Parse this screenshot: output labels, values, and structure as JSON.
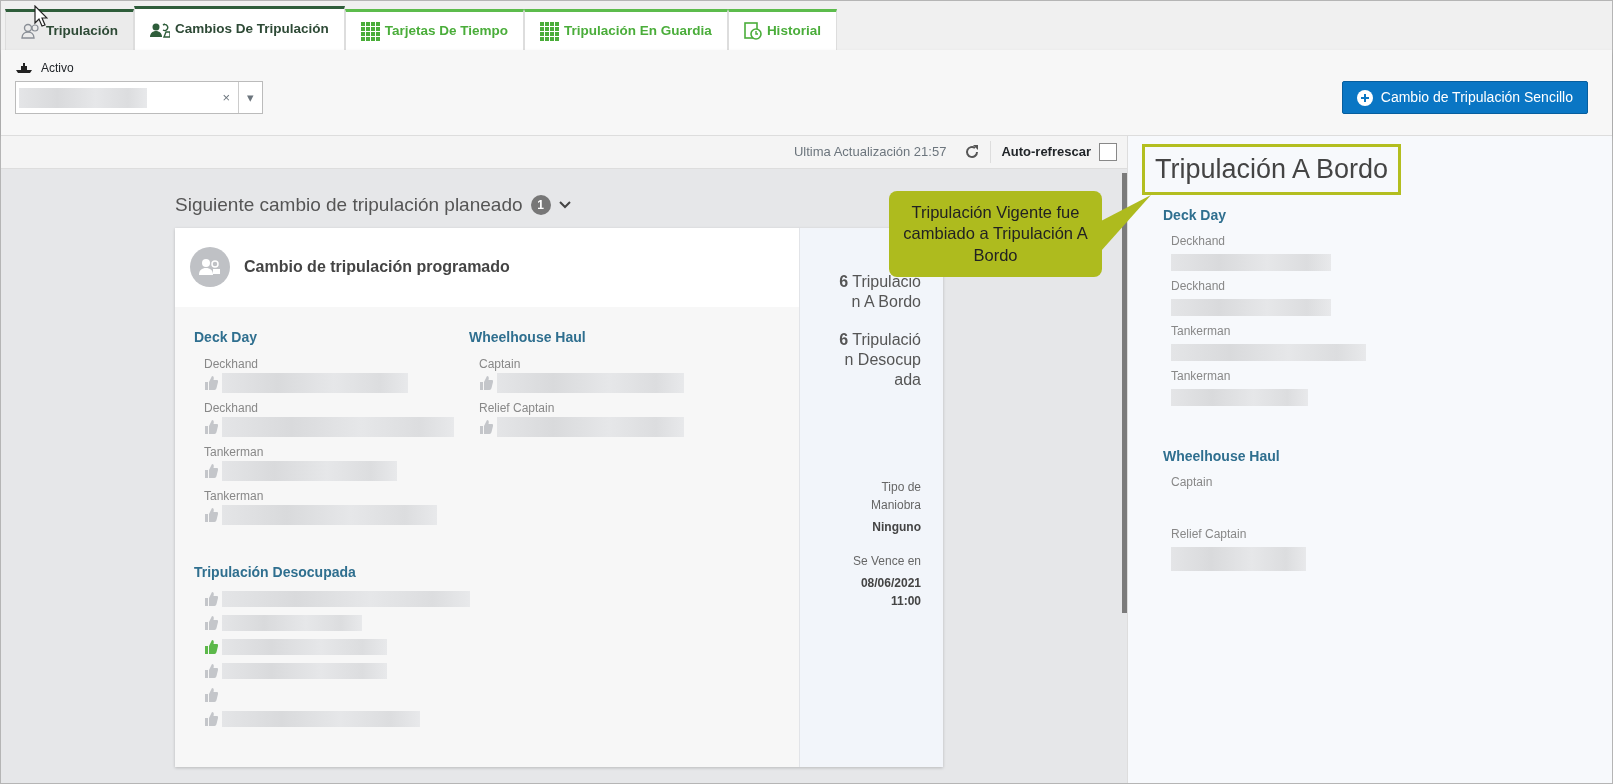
{
  "tabs": [
    {
      "label": "Tripulación",
      "kind": "crew",
      "selected": false
    },
    {
      "label": "Cambios De Tripulación",
      "kind": "crew",
      "selected": true
    },
    {
      "label": "Tarjetas De Tiempo",
      "kind": "module",
      "selected": false
    },
    {
      "label": "Tripulación En Guardia",
      "kind": "module",
      "selected": false
    },
    {
      "label": "Historial",
      "kind": "module",
      "selected": false
    }
  ],
  "asset_filter": {
    "label": "Activo",
    "clear": "×",
    "caret": "▾"
  },
  "primary_action": {
    "label": "Cambio de Tripulación Sencillo"
  },
  "status_strip": {
    "last_update": "Ultima Actualización 21:57",
    "auto_refresh_label": "Auto-refrescar",
    "auto_refresh": false
  },
  "planned": {
    "heading": "Siguiente cambio de tripulación planeado",
    "count": "1",
    "expanded": true,
    "card_title": "Cambio de tripulación programado",
    "groups": [
      {
        "name": "Deck Day",
        "members": [
          {
            "role": "Deckhand",
            "confirmed": false
          },
          {
            "role": "Deckhand",
            "confirmed": false
          },
          {
            "role": "Tankerman",
            "confirmed": false
          },
          {
            "role": "Tankerman",
            "confirmed": false
          }
        ]
      },
      {
        "name": "Wheelhouse Haul",
        "members": [
          {
            "role": "Captain",
            "confirmed": false
          },
          {
            "role": "Relief Captain",
            "confirmed": false
          }
        ]
      }
    ],
    "unassigned": {
      "title": "Tripulación Desocupada",
      "members": [
        {
          "confirmed": false
        },
        {
          "confirmed": false
        },
        {
          "confirmed": true
        },
        {
          "confirmed": false
        },
        {
          "confirmed": false
        },
        {
          "confirmed": false
        }
      ]
    },
    "summary": [
      {
        "count": "6",
        "label": "Tripulación A Bordo"
      },
      {
        "count": "6",
        "label": "Tripulación Desocupada"
      }
    ],
    "details": [
      {
        "label": "Tipo de Maniobra",
        "value": "Ninguno"
      },
      {
        "label": "Se Vence en",
        "value": "08/06/2021 11:00"
      }
    ]
  },
  "callout": {
    "text": "Tripulación Vigente fue cambiado a Tripulación A Bordo"
  },
  "on_board": {
    "title": "Tripulación A Bordo",
    "groups": [
      {
        "name": "Deck Day",
        "members": [
          {
            "role": "Deckhand"
          },
          {
            "role": "Deckhand"
          },
          {
            "role": "Tankerman"
          },
          {
            "role": "Tankerman"
          }
        ]
      },
      {
        "name": "Wheelhouse Haul",
        "members": [
          {
            "role": "Captain"
          },
          {
            "role": "Relief Captain"
          }
        ]
      }
    ]
  }
}
